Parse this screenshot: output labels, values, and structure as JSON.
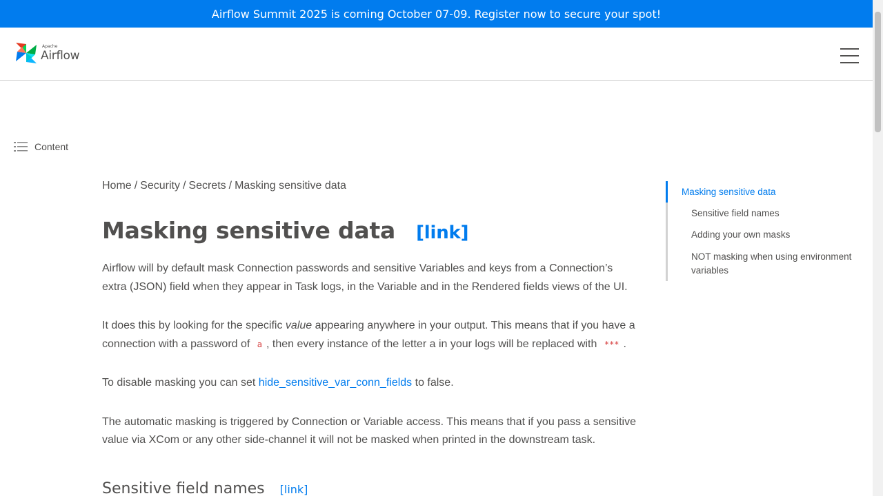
{
  "banner": {
    "text": "Airflow Summit 2025 is coming October 07-09. Register now to secure your spot!"
  },
  "header": {
    "logo_small": "Apache",
    "logo_big": "Airflow",
    "menu_icon": "hamburger-menu-icon"
  },
  "sidebar_toggle": {
    "icon": "list-icon",
    "label": "Content"
  },
  "breadcrumb": {
    "items": [
      "Home",
      "Security",
      "Secrets",
      "Masking sensitive data"
    ],
    "separator": "/"
  },
  "page": {
    "title": "Masking sensitive data",
    "title_link": "[link]",
    "p1": "Airflow will by default mask Connection passwords and sensitive Variables and keys from a Connection’s extra (JSON) field when they appear in Task logs, in the Variable and in the Rendered fields views of the UI.",
    "p2_a": "It does this by looking for the specific ",
    "p2_em": "value",
    "p2_b": " appearing anywhere in your output. This means that if you have a connection with a password of ",
    "p2_code1": "a",
    "p2_c": ", then every instance of the letter a in your logs will be replaced with ",
    "p2_code2": "***",
    "p2_d": ".",
    "p3_a": "To disable masking you can set ",
    "p3_link": "hide_sensitive_var_conn_fields",
    "p3_b": " to false.",
    "p4": "The automatic masking is triggered by Connection or Variable access. This means that if you pass a sensitive value via XCom or any other side-channel it will not be masked when printed in the downstream task.",
    "section_title": "Sensitive field names",
    "section_link": "[link]"
  },
  "toc": {
    "items": [
      "Masking sensitive data",
      "Sensitive field names",
      "Adding your own masks",
      "NOT masking when using environment variables"
    ]
  },
  "colors": {
    "accent": "#017cee",
    "text": "#51504f",
    "code": "#d63b3b"
  }
}
